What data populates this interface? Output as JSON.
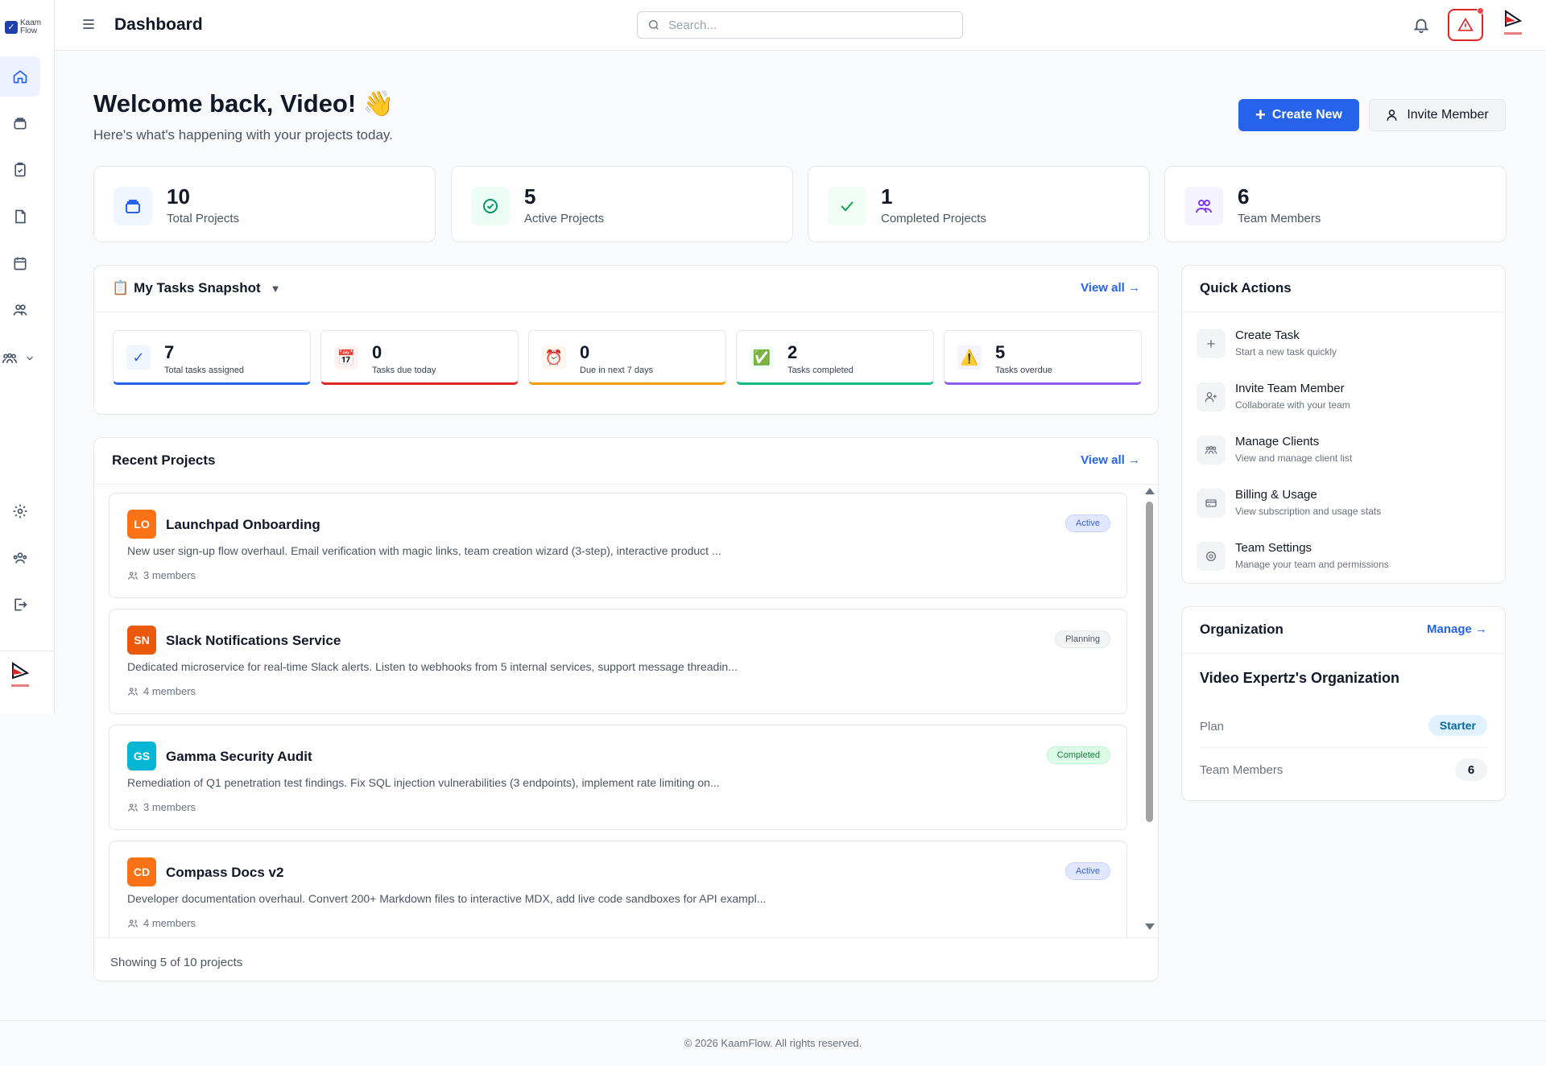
{
  "app": {
    "logo_top": "Kaam",
    "logo_bottom": "Flow"
  },
  "header": {
    "title": "Dashboard",
    "search_placeholder": "Search..."
  },
  "welcome": {
    "title": "Welcome back, Video! 👋",
    "subtitle": "Here's what's happening with your projects today.",
    "create_label": "Create New",
    "invite_label": "Invite Member"
  },
  "stats": [
    {
      "value": "10",
      "label": "Total Projects",
      "icon": "folder-icon"
    },
    {
      "value": "5",
      "label": "Active Projects",
      "icon": "clock-check-icon"
    },
    {
      "value": "1",
      "label": "Completed Projects",
      "icon": "check-icon"
    },
    {
      "value": "6",
      "label": "Team Members",
      "icon": "users-icon"
    }
  ],
  "tasks": {
    "title": "My Tasks Snapshot",
    "view_all": "View all →",
    "items": [
      {
        "value": "7",
        "label": "Total tasks assigned",
        "icon": "✓"
      },
      {
        "value": "0",
        "label": "Tasks due today",
        "icon": "📅"
      },
      {
        "value": "0",
        "label": "Due in next 7 days",
        "icon": "⏰"
      },
      {
        "value": "2",
        "label": "Tasks completed",
        "icon": "✅"
      },
      {
        "value": "5",
        "label": "Tasks overdue",
        "icon": "⚠️"
      }
    ]
  },
  "projects": {
    "title": "Recent Projects",
    "view_all": "View all →",
    "items": [
      {
        "initials": "LO",
        "name": "Launchpad Onboarding",
        "status": "Active",
        "description": "New user sign-up flow overhaul. Email verification with magic links, team creation wizard (3-step), interactive product ...",
        "members": "3 members",
        "color": "#f97316"
      },
      {
        "initials": "SN",
        "name": "Slack Notifications Service",
        "status": "Planning",
        "description": "Dedicated microservice for real-time Slack alerts. Listen to webhooks from 5 internal services, support message threadin...",
        "members": "4 members",
        "color": "#ea580c"
      },
      {
        "initials": "GS",
        "name": "Gamma Security Audit",
        "status": "Completed",
        "description": "Remediation of Q1 penetration test findings. Fix SQL injection vulnerabilities (3 endpoints), implement rate limiting on...",
        "members": "3 members",
        "color": "#06b6d4"
      },
      {
        "initials": "CD",
        "name": "Compass Docs v2",
        "status": "Active",
        "description": "Developer documentation overhaul. Convert 200+ Markdown files to interactive MDX, add live code sandboxes for API exampl...",
        "members": "4 members",
        "color": "#f97316"
      }
    ],
    "showing": "Showing 5 of 10 projects"
  },
  "quick_actions": {
    "title": "Quick Actions",
    "items": [
      {
        "title": "Create Task",
        "subtitle": "Start a new task quickly"
      },
      {
        "title": "Invite Team Member",
        "subtitle": "Collaborate with your team"
      },
      {
        "title": "Manage Clients",
        "subtitle": "View and manage client list"
      },
      {
        "title": "Billing & Usage",
        "subtitle": "View subscription and usage stats"
      },
      {
        "title": "Team Settings",
        "subtitle": "Manage your team and permissions"
      }
    ]
  },
  "organization": {
    "title": "Organization",
    "manage": "Manage →",
    "name": "Video Expertz's Organization",
    "plan_label": "Plan",
    "plan_value": "Starter",
    "members_label": "Team Members",
    "members_value": "6"
  },
  "footer": {
    "text": "© 2026 KaamFlow. All rights reserved."
  },
  "colors": {
    "primary": "#2563eb",
    "danger": "#dc2626"
  }
}
